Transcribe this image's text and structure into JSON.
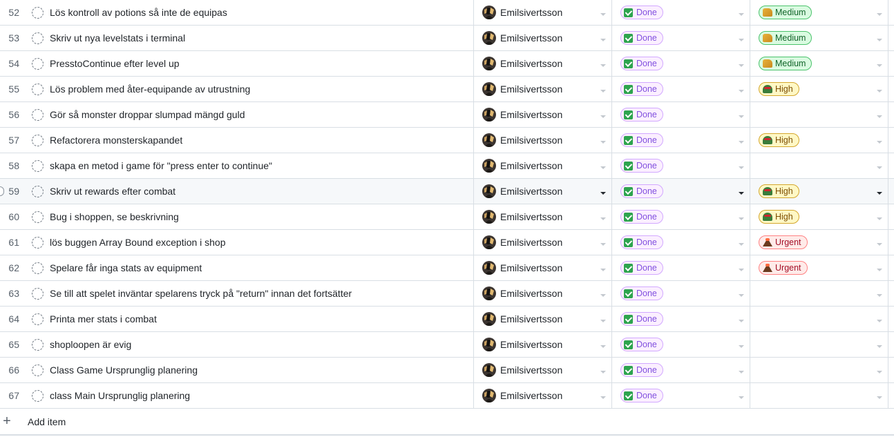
{
  "add_item_label": "Add item",
  "rows": [
    {
      "num": "52",
      "title": "Lös kontroll av potions så inte de equipas",
      "assignee": "Emilsivertsson",
      "status": "Done",
      "priority": "Medium",
      "priority_level": "medium"
    },
    {
      "num": "53",
      "title": "Skriv ut nya levelstats i terminal",
      "assignee": "Emilsivertsson",
      "status": "Done",
      "priority": "Medium",
      "priority_level": "medium"
    },
    {
      "num": "54",
      "title": "PresstoContinue efter level up",
      "assignee": "Emilsivertsson",
      "status": "Done",
      "priority": "Medium",
      "priority_level": "medium"
    },
    {
      "num": "55",
      "title": "Lös problem med åter-equipande av utrustning",
      "assignee": "Emilsivertsson",
      "status": "Done",
      "priority": "High",
      "priority_level": "high"
    },
    {
      "num": "56",
      "title": "Gör så monster droppar slumpad mängd guld",
      "assignee": "Emilsivertsson",
      "status": "Done",
      "priority": "",
      "priority_level": ""
    },
    {
      "num": "57",
      "title": "Refactorera monsterskapandet",
      "assignee": "Emilsivertsson",
      "status": "Done",
      "priority": "High",
      "priority_level": "high"
    },
    {
      "num": "58",
      "title": "skapa en metod i game för \"press enter to continue\"",
      "assignee": "Emilsivertsson",
      "status": "Done",
      "priority": "",
      "priority_level": ""
    },
    {
      "num": "59",
      "title": "Skriv ut rewards efter combat",
      "assignee": "Emilsivertsson",
      "status": "Done",
      "priority": "High",
      "priority_level": "high",
      "hovered": true
    },
    {
      "num": "60",
      "title": "Bug i shoppen, se beskrivning",
      "assignee": "Emilsivertsson",
      "status": "Done",
      "priority": "High",
      "priority_level": "high"
    },
    {
      "num": "61",
      "title": "lös buggen Array Bound exception i shop",
      "assignee": "Emilsivertsson",
      "status": "Done",
      "priority": "Urgent",
      "priority_level": "urgent"
    },
    {
      "num": "62",
      "title": "Spelare får inga stats av equipment",
      "assignee": "Emilsivertsson",
      "status": "Done",
      "priority": "Urgent",
      "priority_level": "urgent"
    },
    {
      "num": "63",
      "title": "Se till att spelet inväntar spelarens tryck på \"return\" innan det fortsätter",
      "assignee": "Emilsivertsson",
      "status": "Done",
      "priority": "",
      "priority_level": ""
    },
    {
      "num": "64",
      "title": "Printa mer stats i combat",
      "assignee": "Emilsivertsson",
      "status": "Done",
      "priority": "",
      "priority_level": ""
    },
    {
      "num": "65",
      "title": "shoploopen är evig",
      "assignee": "Emilsivertsson",
      "status": "Done",
      "priority": "",
      "priority_level": ""
    },
    {
      "num": "66",
      "title": "Class Game Ursprunglig planering",
      "assignee": "Emilsivertsson",
      "status": "Done",
      "priority": "",
      "priority_level": ""
    },
    {
      "num": "67",
      "title": "class Main Ursprunglig planering",
      "assignee": "Emilsivertsson",
      "status": "Done",
      "priority": "",
      "priority_level": ""
    }
  ],
  "colors": {
    "status_done_bg": "#fbefff",
    "status_done_border": "#d2a8ff",
    "status_done_text": "#8250df",
    "check_green": "#2da44e",
    "priority_medium": "#dafbe1",
    "priority_high": "#fff8c5",
    "priority_urgent": "#ffebe9"
  },
  "icons": {
    "draft": "draft-issue-icon",
    "check": "check-box-icon",
    "caret": "caret-down-icon",
    "add": "plus-icon",
    "avatar": "avatar"
  }
}
